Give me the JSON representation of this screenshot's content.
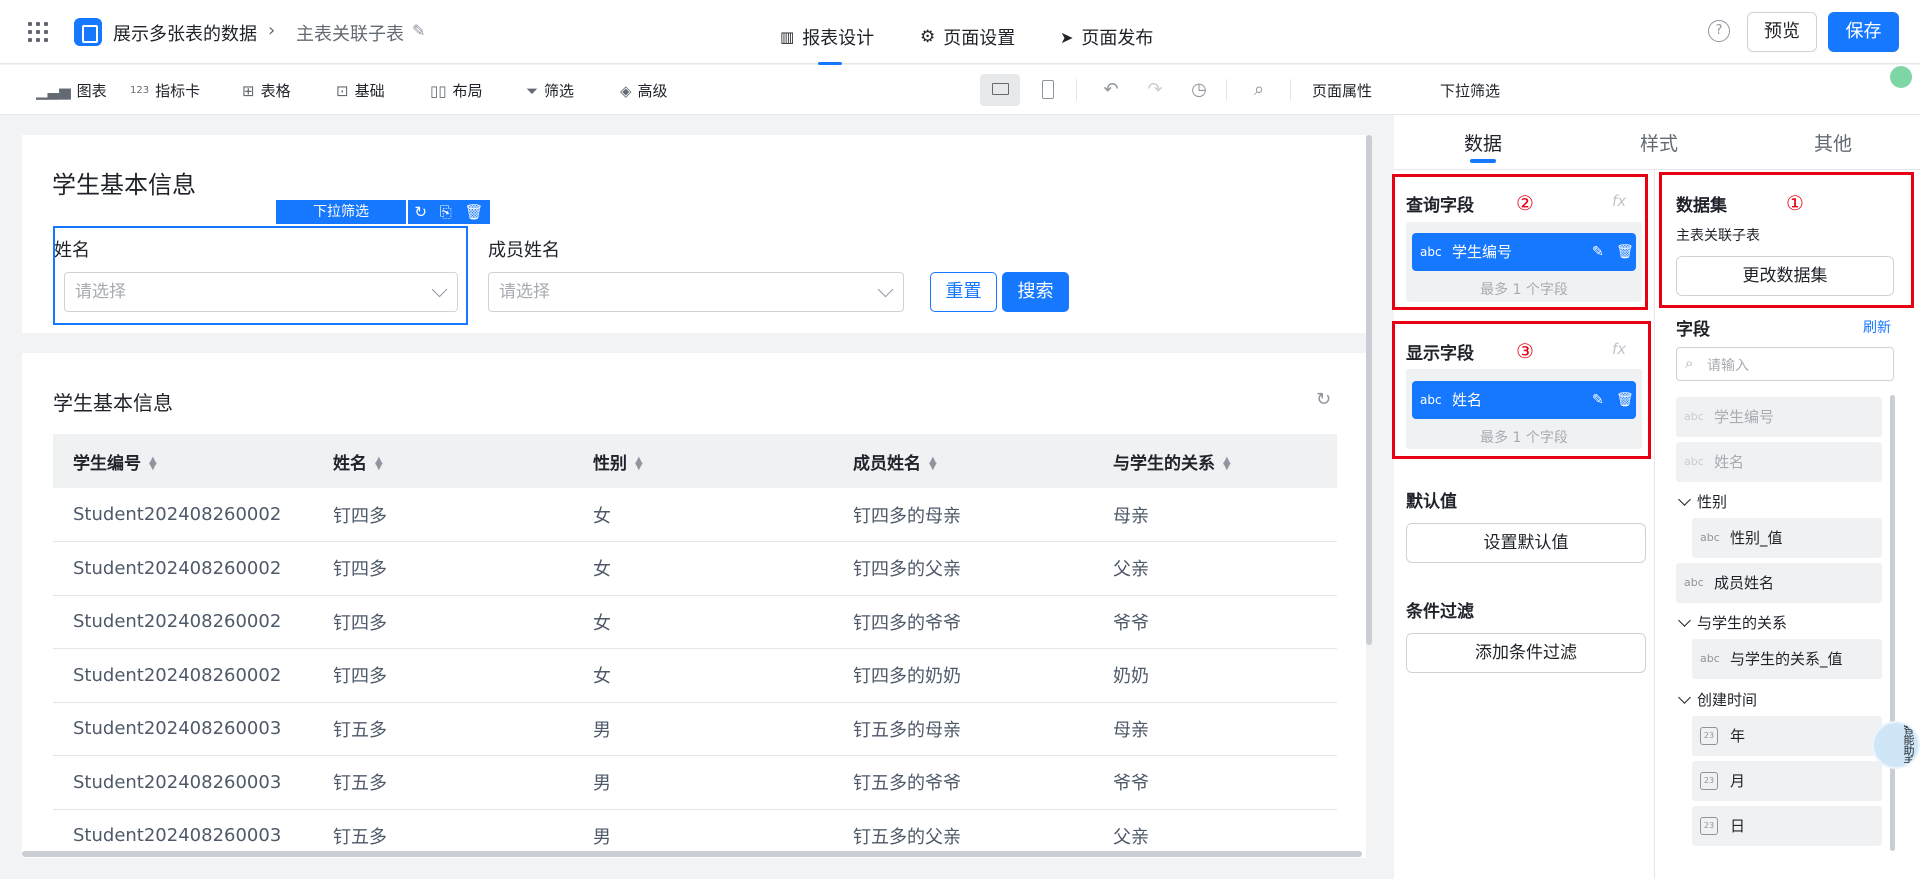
{
  "header": {
    "project_title": "展示多张表的数据",
    "page_name": "主表关联子表",
    "tabs": [
      {
        "label": "报表设计",
        "icon": "report-icon"
      },
      {
        "label": "页面设置",
        "icon": "gear-icon"
      },
      {
        "label": "页面发布",
        "icon": "send-icon"
      }
    ],
    "help": "?",
    "preview_label": "预览",
    "save_label": "保存"
  },
  "toolbar": {
    "items": [
      {
        "label": "图表",
        "icon": "bar-chart-icon"
      },
      {
        "label": "指标卡",
        "icon": "metric-card-icon",
        "prefix": "123"
      },
      {
        "label": "表格",
        "icon": "table-icon"
      },
      {
        "label": "基础",
        "icon": "grid-icon"
      },
      {
        "label": "布局",
        "icon": "layout-icon"
      },
      {
        "label": "筛选",
        "icon": "filter-icon"
      },
      {
        "label": "高级",
        "icon": "layers-icon"
      }
    ],
    "page_props_label": "页面属性"
  },
  "right_header": {
    "component_label": "下拉筛选",
    "status_color": "#7fd6a5"
  },
  "canvas": {
    "filter_card": {
      "title": "学生基本信息",
      "selected_tag": "下拉筛选",
      "field1_label": "姓名",
      "field1_placeholder": "请选择",
      "field2_label": "成员姓名",
      "field2_placeholder": "请选择",
      "reset_label": "重置",
      "search_label": "搜索"
    },
    "table_card": {
      "title": "学生基本信息",
      "columns": [
        "学生编号",
        "姓名",
        "性别",
        "成员姓名",
        "与学生的关系"
      ],
      "rows": [
        [
          "Student202408260002",
          "钉四多",
          "女",
          "钉四多的母亲",
          "母亲"
        ],
        [
          "Student202408260002",
          "钉四多",
          "女",
          "钉四多的父亲",
          "父亲"
        ],
        [
          "Student202408260002",
          "钉四多",
          "女",
          "钉四多的爷爷",
          "爷爷"
        ],
        [
          "Student202408260002",
          "钉四多",
          "女",
          "钉四多的奶奶",
          "奶奶"
        ],
        [
          "Student202408260003",
          "钉五多",
          "男",
          "钉五多的母亲",
          "母亲"
        ],
        [
          "Student202408260003",
          "钉五多",
          "男",
          "钉五多的爷爷",
          "爷爷"
        ],
        [
          "Student202408260003",
          "钉五多",
          "男",
          "钉五多的父亲",
          "父亲"
        ]
      ]
    }
  },
  "right_panel": {
    "tabs": [
      "数据",
      "样式",
      "其他"
    ],
    "query_field": {
      "title": "查询字段",
      "annotation": "②",
      "fx": "fx",
      "chip_type": "abc",
      "chip_name": "学生编号",
      "hint": "最多 1 个字段"
    },
    "display_field": {
      "title": "显示字段",
      "annotation": "③",
      "fx": "fx",
      "chip_type": "abc",
      "chip_name": "姓名",
      "hint": "最多 1 个字段"
    },
    "default_value": {
      "title": "默认值",
      "button_label": "设置默认值"
    },
    "condition_filter": {
      "title": "条件过滤",
      "button_label": "添加条件过滤"
    },
    "dataset": {
      "title": "数据集",
      "annotation": "①",
      "name": "主表关联子表",
      "change_label": "更改数据集"
    },
    "fields": {
      "title": "字段",
      "refresh_label": "刷新",
      "search_placeholder": "请输入",
      "items": [
        {
          "type": "abc",
          "name": "学生编号",
          "disabled": true
        },
        {
          "type": "abc",
          "name": "姓名",
          "disabled": true
        }
      ],
      "group_gender": "性别",
      "gender_item": {
        "type": "abc",
        "name": "性别_值"
      },
      "member_item": {
        "type": "abc",
        "name": "成员姓名"
      },
      "group_relation": "与学生的关系",
      "relation_item": {
        "type": "abc",
        "name": "与学生的关系_值"
      },
      "group_created": "创建时间",
      "date_items": [
        "年",
        "月",
        "日"
      ]
    },
    "floating_badge": "智能助手"
  }
}
